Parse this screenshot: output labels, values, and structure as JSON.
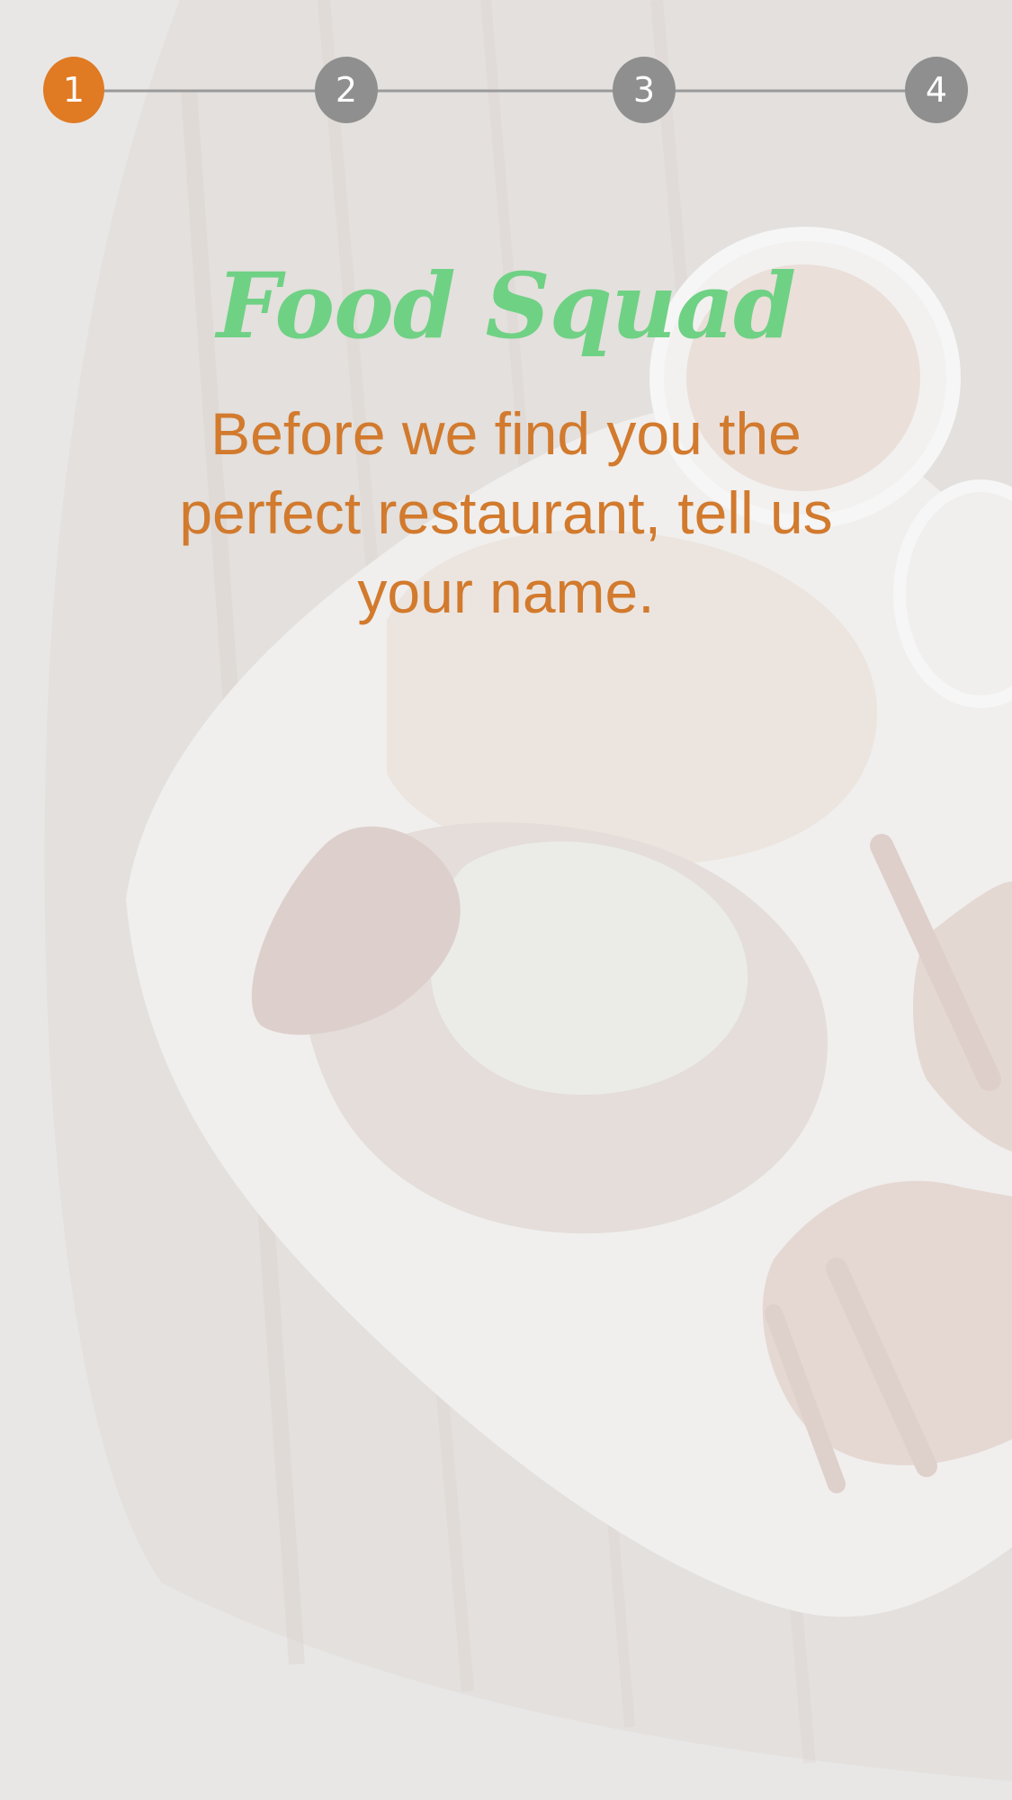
{
  "stepper": {
    "steps": [
      {
        "label": "1",
        "state": "active"
      },
      {
        "label": "2",
        "state": "inactive"
      },
      {
        "label": "3",
        "state": "inactive"
      },
      {
        "label": "4",
        "state": "inactive"
      }
    ]
  },
  "content": {
    "title": "Food Squad",
    "subtitle": "Before we find you the perfect restaurant, tell us your name."
  },
  "colors": {
    "accent": "#e07a23",
    "inactive": "#8f8f8f",
    "title": "#6fd184",
    "subtitle": "#d27a2d"
  }
}
